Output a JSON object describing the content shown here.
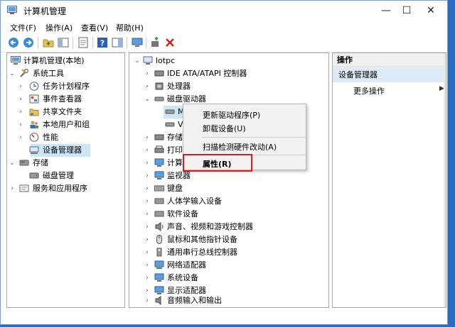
{
  "window": {
    "title": "计算机管理",
    "controls": {
      "minimize": "—",
      "maximize": "☐",
      "close": "✕"
    }
  },
  "menu": [
    "文件(F)",
    "操作(A)",
    "查看(V)",
    "帮助(H)"
  ],
  "left_tree": {
    "root": "计算机管理(本地)",
    "system_tools": "系统工具",
    "items": [
      "任务计划程序",
      "事件查看器",
      "共享文件夹",
      "本地用户和组",
      "性能",
      "设备管理器"
    ],
    "storage": "存储",
    "disk": "磁盘管理",
    "services": "服务和应用程序"
  },
  "device_tree": {
    "root": "lotpc",
    "categories": [
      "IDE ATA/ATAPI 控制器",
      "处理器",
      "磁盘驱动器"
    ],
    "disk_children": [
      "M",
      "V"
    ],
    "partial": [
      "存储",
      "打印",
      "计算",
      "监视器"
    ],
    "rest": [
      "键盘",
      "人体学输入设备",
      "软件设备",
      "声音、视频和游戏控制器",
      "鼠标和其他指针设备",
      "通用串行总线控制器",
      "网络适配器",
      "系统设备",
      "显示适配器",
      "音频输入和输出"
    ]
  },
  "context_menu": {
    "update": "更新驱动程序(P)",
    "uninstall": "卸载设备(U)",
    "scan": "扫描检测硬件改动(A)",
    "properties": "属性(R)"
  },
  "actions": {
    "header": "操作",
    "title": "设备管理器",
    "more": "更多操作",
    "more_arrow": "▶"
  },
  "colors": {
    "desktop": "#2a6cc0",
    "selection": "#cde6f7",
    "highlight_box": "#d62020"
  }
}
